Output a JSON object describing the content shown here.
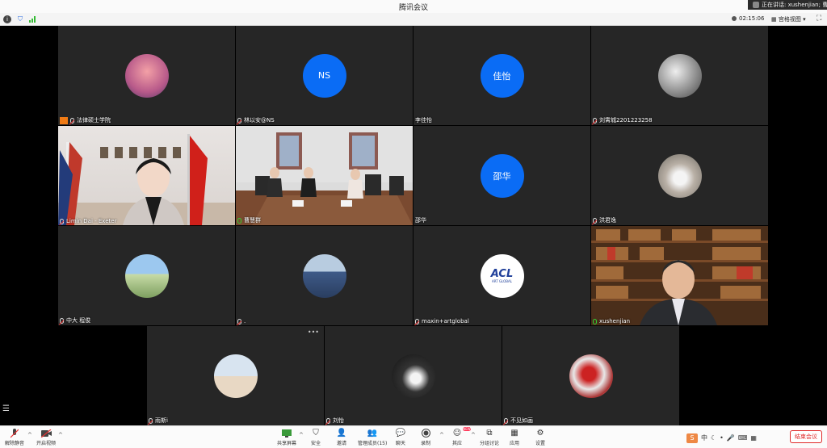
{
  "window": {
    "title": "腾讯会议",
    "speaking": "正在讲话: xushenjian; 曹"
  },
  "topbar": {
    "timer": "02:15:06",
    "view_label": "宫格视图"
  },
  "participants": [
    {
      "name": "法律硕士学院",
      "avatar": "image",
      "host": true
    },
    {
      "name": "林以安@NS",
      "avatar_text": "NS"
    },
    {
      "name": "李佳怡",
      "avatar_text": "佳怡",
      "mic": "none"
    },
    {
      "name": "刘霄城2201223258",
      "avatar": "image"
    },
    {
      "name": "Limin Dai - Exeter",
      "video": true
    },
    {
      "name": "曹慧群",
      "video": true
    },
    {
      "name": "邵华",
      "avatar_text": "邵华",
      "mic": "none"
    },
    {
      "name": "洪君逸",
      "avatar": "image"
    },
    {
      "name": "中大 程俊",
      "avatar": "image"
    },
    {
      "name": ".",
      "avatar": "image"
    },
    {
      "name": "maxin+artglobal",
      "avatar": "logo",
      "logo_text": "ACL",
      "logo_sub": "ART GLOBAL"
    },
    {
      "name": "xushenjian",
      "video": true,
      "active": true
    },
    {
      "name": "雨斯i",
      "avatar": "image"
    },
    {
      "name": "刘怡",
      "avatar": "image"
    },
    {
      "name": "不见如画",
      "avatar": "image"
    }
  ],
  "toolbar": {
    "mute": "解除静音",
    "video": "开启视频",
    "share": "共享屏幕",
    "security": "安全",
    "invite": "邀请",
    "members": "管理成员(15)",
    "chat": "聊天",
    "record": "录制",
    "reactions": "其应",
    "breakout": "分组讨论",
    "apps": "应用",
    "settings": "设置",
    "end": "结束会议",
    "new_badge": "NEW"
  },
  "tray": {
    "ime": "S",
    "lang": "中"
  },
  "colors": {
    "accent": "#0a6cf5",
    "end": "#e02a2a",
    "active_border": "#3bbd3b"
  }
}
